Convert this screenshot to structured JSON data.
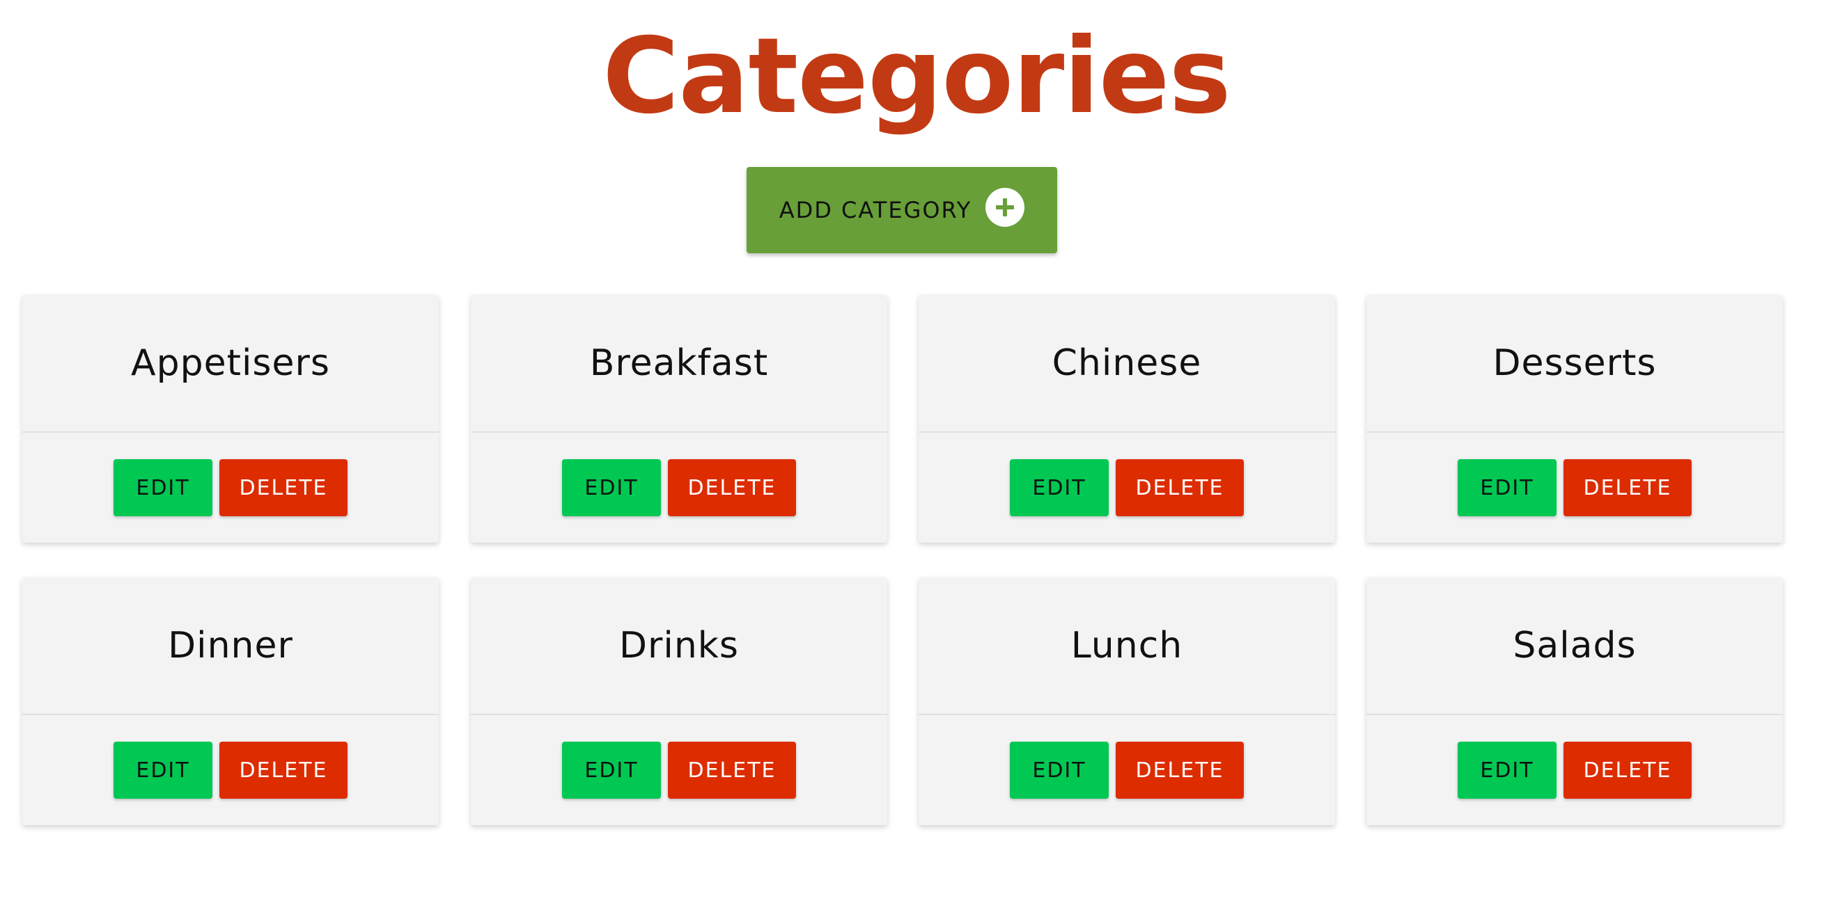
{
  "colors": {
    "title": "#c23a14",
    "add_button": "#689f38",
    "edit_button": "#00c853",
    "delete_button": "#dd2c00",
    "card_background": "#f3f3f3"
  },
  "header": {
    "title": "Categories"
  },
  "add_button": {
    "label": "ADD CATEGORY",
    "icon": "plus-circle-icon"
  },
  "cards": [
    {
      "name": "Appetisers",
      "edit_label": "EDIT",
      "delete_label": "DELETE"
    },
    {
      "name": "Breakfast",
      "edit_label": "EDIT",
      "delete_label": "DELETE"
    },
    {
      "name": "Chinese",
      "edit_label": "EDIT",
      "delete_label": "DELETE"
    },
    {
      "name": "Desserts",
      "edit_label": "EDIT",
      "delete_label": "DELETE"
    },
    {
      "name": "Dinner",
      "edit_label": "EDIT",
      "delete_label": "DELETE"
    },
    {
      "name": "Drinks",
      "edit_label": "EDIT",
      "delete_label": "DELETE"
    },
    {
      "name": "Lunch",
      "edit_label": "EDIT",
      "delete_label": "DELETE"
    },
    {
      "name": "Salads",
      "edit_label": "EDIT",
      "delete_label": "DELETE"
    }
  ]
}
